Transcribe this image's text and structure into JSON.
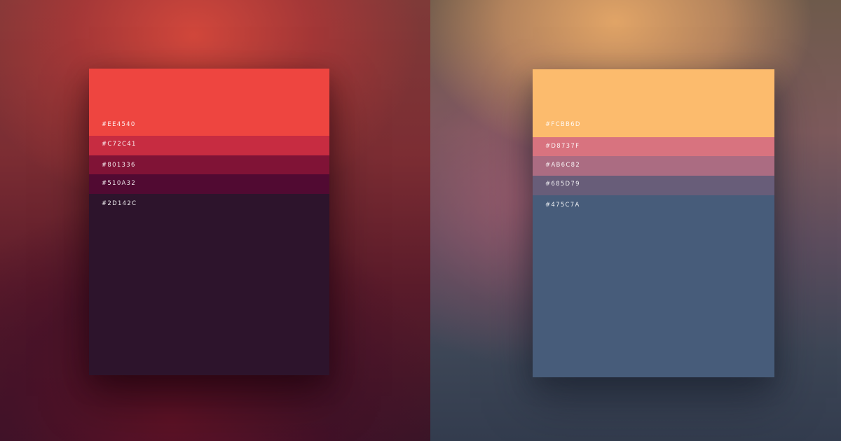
{
  "palettes": [
    {
      "swatches": [
        {
          "code": "#EE4540",
          "color": "#EE4540"
        },
        {
          "code": "#C72C41",
          "color": "#C72C41"
        },
        {
          "code": "#801336",
          "color": "#801336"
        },
        {
          "code": "#510A32",
          "color": "#510A32"
        },
        {
          "code": "#2D142C",
          "color": "#2D142C"
        }
      ]
    },
    {
      "swatches": [
        {
          "code": "#FCBB6D",
          "color": "#FCBB6D"
        },
        {
          "code": "#D8737F",
          "color": "#D8737F"
        },
        {
          "code": "#AB6C82",
          "color": "#AB6C82"
        },
        {
          "code": "#685D79",
          "color": "#685D79"
        },
        {
          "code": "#475C7A",
          "color": "#475C7A"
        }
      ]
    }
  ]
}
